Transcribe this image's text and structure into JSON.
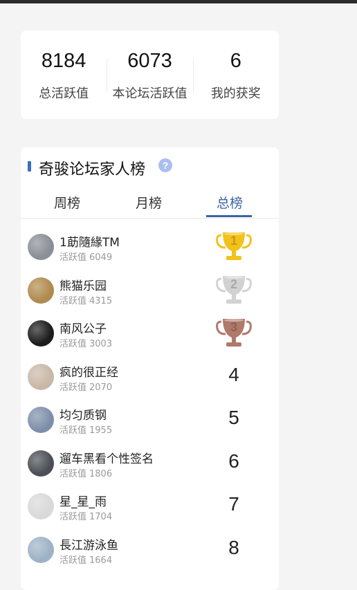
{
  "stats": [
    {
      "value": "8184",
      "label": "总活跃值"
    },
    {
      "value": "6073",
      "label": "本论坛活跃值"
    },
    {
      "value": "6",
      "label": "我的获奖"
    }
  ],
  "ranking": {
    "title": "奇骏论坛家人榜",
    "help": "?",
    "tabs": [
      "周榜",
      "月榜",
      "总榜"
    ],
    "active_tab": "总榜",
    "score_label": "活跃值",
    "rows": [
      {
        "rank": "1",
        "name": "1莇隨緣TM",
        "score": "6049",
        "avatar_color": "#8a8f96"
      },
      {
        "rank": "2",
        "name": "熊猫乐园",
        "score": "4315",
        "avatar_color": "#b08a4e"
      },
      {
        "rank": "3",
        "name": "南风公子",
        "score": "3003",
        "avatar_color": "#1c1c1c"
      },
      {
        "rank": "4",
        "name": "疯的很正经",
        "score": "2070",
        "avatar_color": "#c9b8a6"
      },
      {
        "rank": "5",
        "name": "均匀质钢",
        "score": "1955",
        "avatar_color": "#7d8fa8"
      },
      {
        "rank": "6",
        "name": "遛车黑看个性签名",
        "score": "1806",
        "avatar_color": "#4a4f55"
      },
      {
        "rank": "7",
        "name": "星_星_雨",
        "score": "1704",
        "avatar_color": "#d9d9d9"
      },
      {
        "rank": "8",
        "name": "長江游泳鱼",
        "score": "1664",
        "avatar_color": "#9db2c6"
      }
    ]
  },
  "colors": {
    "accent": "#3a63a8",
    "gold": "#f2c21b",
    "silver": "#d2d2d2",
    "bronze": "#b0796a"
  }
}
